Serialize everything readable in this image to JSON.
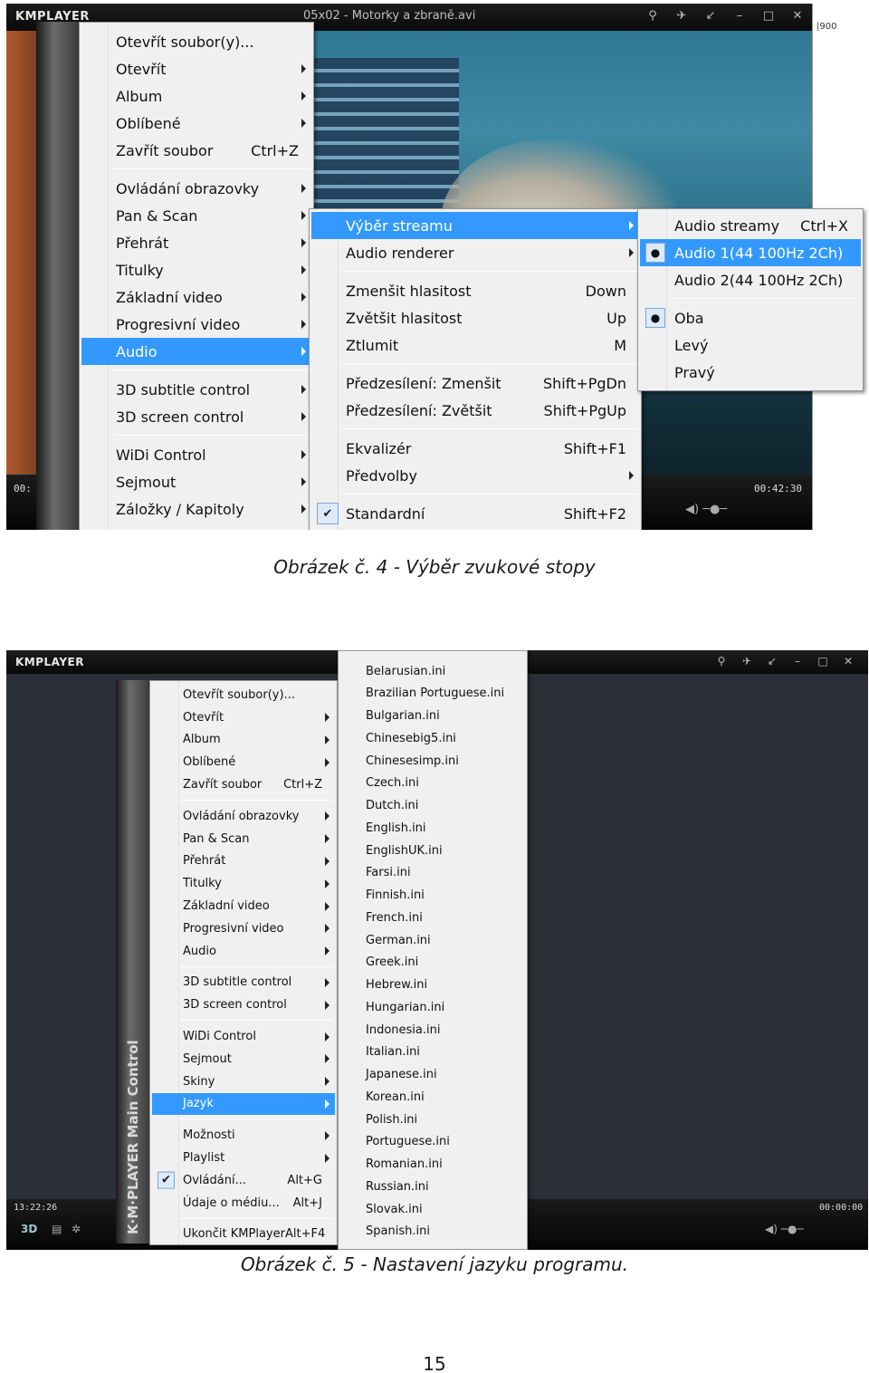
{
  "figure1": {
    "app_logo": "KMPLAYER",
    "window_title": "05x02 - Motorky a zbraně.avi",
    "time_left": "00:",
    "time_right": "00:42:30",
    "ruler_text": "|900",
    "main_menu": [
      {
        "label": "Otevřít soubor(y)...",
        "shortcut": "",
        "submenu": false
      },
      {
        "label": "Otevřít",
        "shortcut": "",
        "submenu": true
      },
      {
        "label": "Album",
        "shortcut": "",
        "submenu": true
      },
      {
        "label": "Oblíbené",
        "shortcut": "",
        "submenu": true
      },
      {
        "label": "Zavřít soubor",
        "shortcut": "Ctrl+Z",
        "submenu": false
      },
      {
        "sep": true
      },
      {
        "label": "Ovládání obrazovky",
        "shortcut": "",
        "submenu": true
      },
      {
        "label": "Pan & Scan",
        "shortcut": "",
        "submenu": true
      },
      {
        "label": "Přehrát",
        "shortcut": "",
        "submenu": true
      },
      {
        "label": "Titulky",
        "shortcut": "",
        "submenu": true
      },
      {
        "label": "Základní video",
        "shortcut": "",
        "submenu": true
      },
      {
        "label": "Progresivní video",
        "shortcut": "",
        "submenu": true
      },
      {
        "label": "Audio",
        "shortcut": "",
        "submenu": true,
        "highlight": true
      },
      {
        "sep": true
      },
      {
        "label": "3D subtitle control",
        "shortcut": "",
        "submenu": true
      },
      {
        "label": "3D screen control",
        "shortcut": "",
        "submenu": true
      },
      {
        "sep": true
      },
      {
        "label": "WiDi Control",
        "shortcut": "",
        "submenu": true
      },
      {
        "label": "Sejmout",
        "shortcut": "",
        "submenu": true
      },
      {
        "label": "Záložky / Kapitoly",
        "shortcut": "",
        "submenu": true
      }
    ],
    "audio_menu": [
      {
        "label": "Výběr streamu",
        "shortcut": "",
        "submenu": true,
        "highlight": true
      },
      {
        "label": "Audio renderer",
        "shortcut": "",
        "submenu": true
      },
      {
        "sep": true
      },
      {
        "label": "Zmenšit hlasitost",
        "shortcut": "Down",
        "submenu": false
      },
      {
        "label": "Zvětšit hlasitost",
        "shortcut": "Up",
        "submenu": false
      },
      {
        "label": "Ztlumit",
        "shortcut": "M",
        "submenu": false
      },
      {
        "sep": true
      },
      {
        "label": "Předzesílení: Zmenšit",
        "shortcut": "Shift+PgDn",
        "submenu": false
      },
      {
        "label": "Předzesílení: Zvětšit",
        "shortcut": "Shift+PgUp",
        "submenu": false
      },
      {
        "sep": true
      },
      {
        "label": "Ekvalizér",
        "shortcut": "Shift+F1",
        "submenu": false
      },
      {
        "label": "Předvolby",
        "shortcut": "",
        "submenu": true
      },
      {
        "sep": true
      },
      {
        "label": "Standardní",
        "shortcut": "Shift+F2",
        "submenu": false,
        "checked": true
      }
    ],
    "stream_menu": [
      {
        "label": "Audio streamy",
        "shortcut": "Ctrl+X",
        "submenu": false
      },
      {
        "label": "Audio 1(44 100Hz 2Ch)",
        "shortcut": "",
        "radio": true,
        "highlight": true
      },
      {
        "label": "Audio 2(44 100Hz 2Ch)",
        "shortcut": ""
      },
      {
        "sep": true
      },
      {
        "label": "Oba",
        "shortcut": "",
        "radio": true
      },
      {
        "label": "Levý",
        "shortcut": ""
      },
      {
        "label": "Pravý",
        "shortcut": ""
      }
    ],
    "caption": "Obrázek č. 4 - Výběr zvukové stopy"
  },
  "figure2": {
    "app_logo": "KMPLAYER",
    "time_left": "13:22:26",
    "time_right": "00:00:00",
    "sidebar_text": "K·M·PLAYER  Main Control",
    "main_menu": [
      {
        "label": "Otevřít soubor(y)...",
        "shortcut": "",
        "submenu": false
      },
      {
        "label": "Otevřít",
        "shortcut": "",
        "submenu": true
      },
      {
        "label": "Album",
        "shortcut": "",
        "submenu": true
      },
      {
        "label": "Oblíbené",
        "shortcut": "",
        "submenu": true
      },
      {
        "label": "Zavřít soubor",
        "shortcut": "Ctrl+Z",
        "submenu": false
      },
      {
        "sep": true
      },
      {
        "label": "Ovládání obrazovky",
        "shortcut": "",
        "submenu": true
      },
      {
        "label": "Pan & Scan",
        "shortcut": "",
        "submenu": true
      },
      {
        "label": "Přehrát",
        "shortcut": "",
        "submenu": true
      },
      {
        "label": "Titulky",
        "shortcut": "",
        "submenu": true
      },
      {
        "label": "Základní video",
        "shortcut": "",
        "submenu": true
      },
      {
        "label": "Progresivní video",
        "shortcut": "",
        "submenu": true
      },
      {
        "label": "Audio",
        "shortcut": "",
        "submenu": true
      },
      {
        "sep": true
      },
      {
        "label": "3D subtitle control",
        "shortcut": "",
        "submenu": true
      },
      {
        "label": "3D screen control",
        "shortcut": "",
        "submenu": true
      },
      {
        "sep": true
      },
      {
        "label": "WiDi Control",
        "shortcut": "",
        "submenu": true
      },
      {
        "label": "Sejmout",
        "shortcut": "",
        "submenu": true
      },
      {
        "label": "Skiny",
        "shortcut": "",
        "submenu": true
      },
      {
        "label": "Jazyk",
        "shortcut": "",
        "submenu": true,
        "highlight": true
      },
      {
        "sep": true
      },
      {
        "label": "Možnosti",
        "shortcut": "",
        "submenu": true
      },
      {
        "label": "Playlist",
        "shortcut": "",
        "submenu": true
      },
      {
        "label": "Ovládání...",
        "shortcut": "Alt+G",
        "submenu": false,
        "checked": true
      },
      {
        "label": "Údaje o médiu...",
        "shortcut": "Alt+J",
        "submenu": false
      },
      {
        "sep": true
      },
      {
        "label": "Ukončit KMPlayer",
        "shortcut": "Alt+F4",
        "submenu": false
      }
    ],
    "languages": [
      "Belarusian.ini",
      "Brazilian Portuguese.ini",
      "Bulgarian.ini",
      "Chinesebig5.ini",
      "Chinesesimp.ini",
      "Czech.ini",
      "Dutch.ini",
      "English.ini",
      "EnglishUK.ini",
      "Farsi.ini",
      "Finnish.ini",
      "French.ini",
      "German.ini",
      "Greek.ini",
      "Hebrew.ini",
      "Hungarian.ini",
      "Indonesia.ini",
      "Italian.ini",
      "Japanese.ini",
      "Korean.ini",
      "Polish.ini",
      "Portuguese.ini",
      "Romanian.ini",
      "Russian.ini",
      "Slovak.ini",
      "Spanish.ini"
    ],
    "caption": "Obrázek č. 5 - Nastavení jazyku programu."
  },
  "page_number": "15"
}
